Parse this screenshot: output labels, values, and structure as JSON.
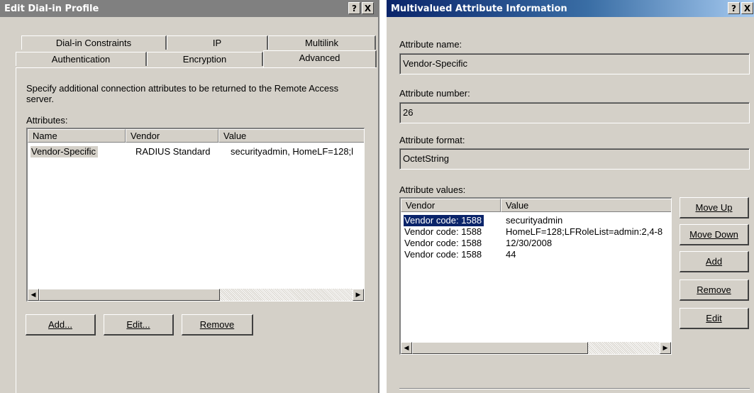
{
  "left_dialog": {
    "title": "Edit Dial-in Profile",
    "help_glyph": "?",
    "close_glyph": "X",
    "tabs_back": [
      "Dial-in Constraints",
      "IP",
      "Multilink"
    ],
    "tabs_front": [
      "Authentication",
      "Encryption",
      "Advanced"
    ],
    "active_tab": "Advanced",
    "description": "Specify additional connection attributes to be returned to the Remote Access server.",
    "attributes_label": "Attributes:",
    "columns": [
      "Name",
      "Vendor",
      "Value"
    ],
    "rows": [
      {
        "name": "Vendor-Specific",
        "vendor": "RADIUS Standard",
        "value": "securityadmin, HomeLF=128;l"
      }
    ],
    "buttons": {
      "add": "Add...",
      "edit": "Edit...",
      "remove": "Remove"
    }
  },
  "right_dialog": {
    "title": "Multivalued Attribute Information",
    "help_glyph": "?",
    "close_glyph": "X",
    "attribute_name_label": "Attribute name:",
    "attribute_name": "Vendor-Specific",
    "attribute_number_label": "Attribute number:",
    "attribute_number": "26",
    "attribute_format_label": "Attribute format:",
    "attribute_format": "OctetString",
    "attribute_values_label": "Attribute values:",
    "columns": [
      "Vendor",
      "Value"
    ],
    "rows": [
      {
        "vendor": "Vendor code: 1588",
        "value": "securityadmin"
      },
      {
        "vendor": "Vendor code: 1588",
        "value": "HomeLF=128;LFRoleList=admin:2,4-8"
      },
      {
        "vendor": "Vendor code: 1588",
        "value": "12/30/2008"
      },
      {
        "vendor": "Vendor code: 1588",
        "value": "44"
      }
    ],
    "buttons": {
      "move_up": "Move Up",
      "move_down": "Move Down",
      "add": "Add",
      "remove": "Remove",
      "edit": "Edit"
    }
  },
  "scroll_glyphs": {
    "left": "◀",
    "right": "▶"
  },
  "colors": {
    "face": "#d4d0c8",
    "title_active": "#0a246a",
    "title_inactive": "#808080",
    "selection": "#0a246a"
  }
}
